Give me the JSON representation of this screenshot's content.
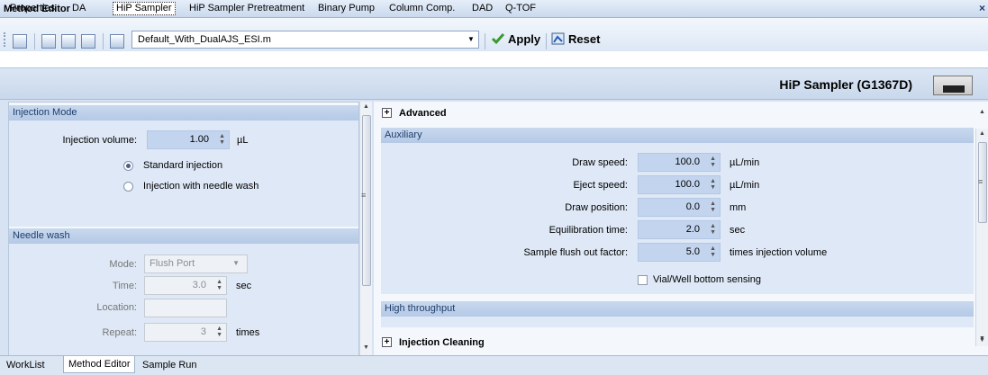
{
  "window": {
    "title": "Method Editor",
    "close": "×"
  },
  "toolbar": {
    "method_file": "Default_With_DualAJS_ESI.m",
    "apply_label": "Apply",
    "reset_label": "Reset",
    "icons": [
      "home-icon",
      "open-icon",
      "save-icon",
      "save-as-icon",
      "report-icon"
    ]
  },
  "tabs": [
    "Properties",
    "DA",
    "HiP Sampler",
    "HiP Sampler Pretreatment",
    "Binary Pump",
    "Column Comp.",
    "DAD",
    "Q-TOF"
  ],
  "active_tab": "HiP Sampler",
  "header": {
    "module_title": "HiP Sampler (G1367D)"
  },
  "injection_mode": {
    "section_title": "Injection Mode",
    "volume_label": "Injection volume:",
    "volume_value": "1.00",
    "volume_unit": "µL",
    "options": [
      "Standard injection",
      "Injection with needle wash"
    ],
    "selected": "Standard injection"
  },
  "needle_wash": {
    "section_title": "Needle wash",
    "mode_label": "Mode:",
    "mode_value": "Flush Port",
    "time_label": "Time:",
    "time_value": "3.0",
    "time_unit": "sec",
    "location_label": "Location:",
    "location_value": "",
    "repeat_label": "Repeat:",
    "repeat_value": "3",
    "repeat_unit": "times"
  },
  "advanced": {
    "title": "Advanced",
    "auxiliary": {
      "section_title": "Auxiliary",
      "rows": [
        {
          "label": "Draw speed:",
          "value": "100.0",
          "unit": "µL/min"
        },
        {
          "label": "Eject speed:",
          "value": "100.0",
          "unit": "µL/min"
        },
        {
          "label": "Draw position:",
          "value": "0.0",
          "unit": "mm"
        },
        {
          "label": "Equilibration time:",
          "value": "2.0",
          "unit": "sec"
        },
        {
          "label": "Sample flush out factor:",
          "value": "5.0",
          "unit": "times injection volume"
        }
      ],
      "checkbox_label": "Vial/Well bottom sensing"
    },
    "high_throughput_title": "High throughput",
    "injection_cleaning_title": "Injection Cleaning"
  },
  "bottom_tabs": [
    "WorkList",
    "Method Editor",
    "Sample Run"
  ],
  "active_bottom_tab": "Method Editor"
}
